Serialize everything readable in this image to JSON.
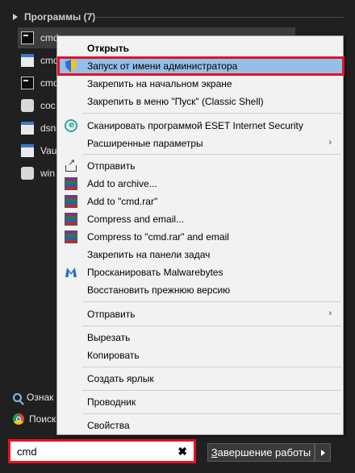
{
  "programs_group": {
    "label": "Программы (7)"
  },
  "programs": [
    {
      "label": "cmd",
      "icon": "cmd-icon"
    },
    {
      "label": "cmd",
      "icon": "window-icon"
    },
    {
      "label": "cmd",
      "icon": "cmd-tool-icon"
    },
    {
      "label": "coc",
      "icon": "gear-icon"
    },
    {
      "label": "dsn",
      "icon": "window-icon"
    },
    {
      "label": "Vau",
      "icon": "window-icon"
    },
    {
      "label": "win",
      "icon": "gear-icon"
    }
  ],
  "search_results": [
    {
      "label": "Ознак",
      "icon": "search-icon"
    },
    {
      "label": "Поиск",
      "icon": "chrome-icon"
    }
  ],
  "search": {
    "value": "cmd",
    "clear_label": "✖"
  },
  "shutdown": {
    "accel": "З",
    "label_rest": "авершение работы"
  },
  "menu": {
    "items": [
      {
        "label": "Открыть",
        "bold": true
      },
      {
        "label": "Запуск от имени администратора",
        "icon": "shield-icon",
        "highlighted": true
      },
      {
        "label": "Закрепить на начальном экране"
      },
      {
        "label": "Закрепить в меню \"Пуск\" (Classic Shell)"
      },
      {
        "label": "Сканировать программой ESET Internet Security",
        "icon": "eset-icon"
      },
      {
        "label": "Расширенные параметры",
        "submenu": true
      },
      {
        "label": "Отправить",
        "icon": "share-icon"
      },
      {
        "label": "Add to archive...",
        "icon": "winrar-icon"
      },
      {
        "label": "Add to \"cmd.rar\"",
        "icon": "winrar-icon"
      },
      {
        "label": "Compress and email...",
        "icon": "winrar-icon"
      },
      {
        "label": "Compress to \"cmd.rar\" and email",
        "icon": "winrar-icon"
      },
      {
        "label": "Закрепить на панели задач"
      },
      {
        "label": "Просканировать Malwarebytes",
        "icon": "malwarebytes-icon"
      },
      {
        "label": "Восстановить прежнюю версию"
      },
      {
        "label": "Отправить",
        "submenu": true
      },
      {
        "label": "Вырезать"
      },
      {
        "label": "Копировать"
      },
      {
        "label": "Создать ярлык"
      },
      {
        "label": "Проводник"
      },
      {
        "label": "Свойства"
      }
    ],
    "submenu_arrow": "›"
  },
  "colors": {
    "highlight": "#92c0e9",
    "annotation_border": "#e8101f",
    "menu_bg": "#f2f2f2",
    "panel_bg": "#202020"
  }
}
